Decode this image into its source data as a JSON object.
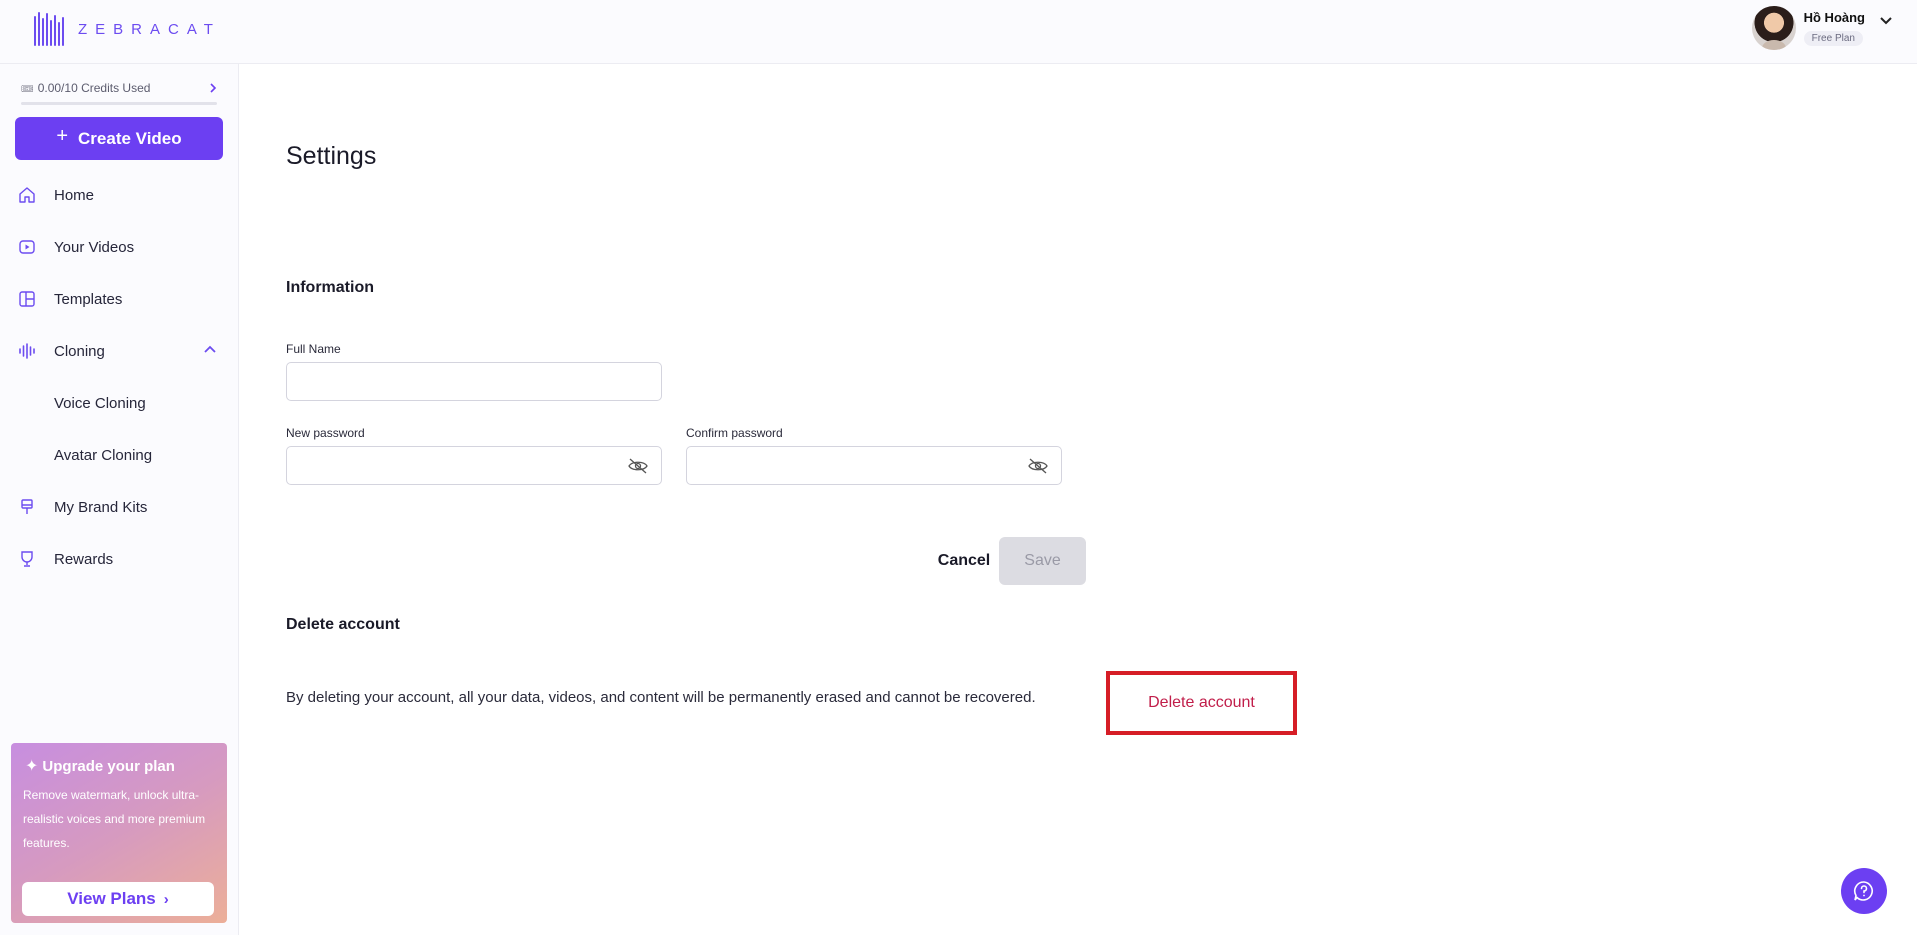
{
  "brand": {
    "name": "ZEBRACAT",
    "accent": "#6c3ff2"
  },
  "user": {
    "name": "Hồ Hoàng",
    "plan": "Free Plan"
  },
  "credits": {
    "label": "0.00/10 Credits Used",
    "used_fraction": 0.0
  },
  "sidebar": {
    "create_label": "Create Video",
    "items": [
      {
        "label": "Home",
        "icon": "home-icon"
      },
      {
        "label": "Your Videos",
        "icon": "video-icon"
      },
      {
        "label": "Templates",
        "icon": "templates-icon"
      },
      {
        "label": "Cloning",
        "icon": "waveform-icon",
        "expanded": true
      },
      {
        "label": "Voice Cloning",
        "sub": true
      },
      {
        "label": "Avatar Cloning",
        "sub": true
      },
      {
        "label": "My Brand Kits",
        "icon": "brush-icon"
      },
      {
        "label": "Rewards",
        "icon": "trophy-icon"
      }
    ],
    "upgrade": {
      "title": "Upgrade your plan",
      "description": "Remove watermark, unlock ultra-realistic voices and more premium features.",
      "button_label": "View Plans"
    }
  },
  "main": {
    "title": "Settings",
    "information": {
      "heading": "Information",
      "full_name_label": "Full Name",
      "full_name_value": "",
      "new_password_label": "New password",
      "confirm_password_label": "Confirm password"
    },
    "cancel_label": "Cancel",
    "save_label": "Save",
    "delete": {
      "heading": "Delete account",
      "description": "By deleting your account, all your data, videos, and content will be permanently erased and cannot be recovered.",
      "button_label": "Delete account",
      "highlight_color": "#d61d26"
    }
  }
}
